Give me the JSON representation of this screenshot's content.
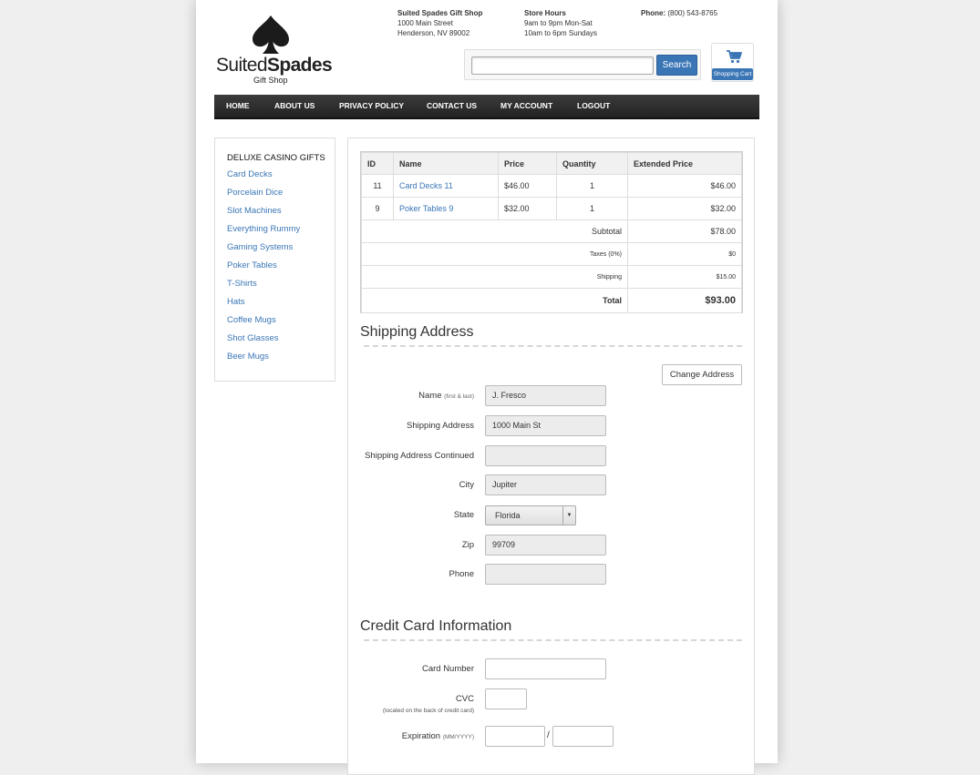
{
  "brand": {
    "name_light": "Suited",
    "name_bold": "Spades",
    "sub": "Gift Shop"
  },
  "header": {
    "shop_name": "Suited Spades Gift Shop",
    "address_line1": "1000 Main Street",
    "address_line2": "Henderson, NV 89002",
    "hours_title": "Store Hours",
    "hours_line1": "9am to 9pm Mon-Sat",
    "hours_line2": "10am to 6pm Sundays",
    "phone_label": "Phone:",
    "phone_value": "(800) 543-8765"
  },
  "search": {
    "placeholder": "",
    "button_label": "Search"
  },
  "cart": {
    "label": "Shopping Cart"
  },
  "nav": [
    "HOME",
    "ABOUT US",
    "PRIVACY POLICY",
    "CONTACT US",
    "MY ACCOUNT",
    "LOGOUT"
  ],
  "sidebar": {
    "heading": "DELUXE CASINO GIFTS",
    "items": [
      "Card Decks",
      "Porcelain Dice",
      "Slot Machines",
      "Everything Rummy",
      "Gaming Systems",
      "Poker Tables",
      "T-Shirts",
      "Hats",
      "Coffee Mugs",
      "Shot Glasses",
      "Beer Mugs"
    ]
  },
  "order": {
    "columns": [
      "ID",
      "Name",
      "Price",
      "Quantity",
      "Extended Price"
    ],
    "rows": [
      {
        "id": "11",
        "name": "Card Decks 11",
        "price": "$46.00",
        "qty": "1",
        "ext": "$46.00"
      },
      {
        "id": "9",
        "name": "Poker Tables 9",
        "price": "$32.00",
        "qty": "1",
        "ext": "$32.00"
      }
    ],
    "subtotal_label": "Subtotal",
    "subtotal": "$78.00",
    "taxes_label": "Taxes (0%)",
    "taxes": "$0",
    "shipping_label": "Shipping",
    "shipping": "$15.00",
    "total_label": "Total",
    "total": "$93.00"
  },
  "shipping_form": {
    "title": "Shipping Address",
    "change_button": "Change Address",
    "name_label": "Name",
    "name_hint": "(first & last)",
    "name_value": "J. Fresco",
    "address_label": "Shipping Address",
    "address_value": "1000 Main St",
    "address2_label": "Shipping Address Continued",
    "address2_value": "",
    "city_label": "City",
    "city_value": "Jupiter",
    "state_label": "State",
    "state_value": "Florida",
    "zip_label": "Zip",
    "zip_value": "99709",
    "phone_label": "Phone",
    "phone_value": ""
  },
  "card_form": {
    "title": "Credit Card Information",
    "number_label": "Card Number",
    "cvc_label": "CVC",
    "cvc_note": "(located on the back of credit card)",
    "exp_label": "Expiration",
    "exp_hint": "(MM/YYYY)",
    "exp_separator": "/"
  },
  "colors": {
    "link": "#3a76b6",
    "button": "#3a76b6",
    "nav_bg": "#2c2c2c"
  }
}
